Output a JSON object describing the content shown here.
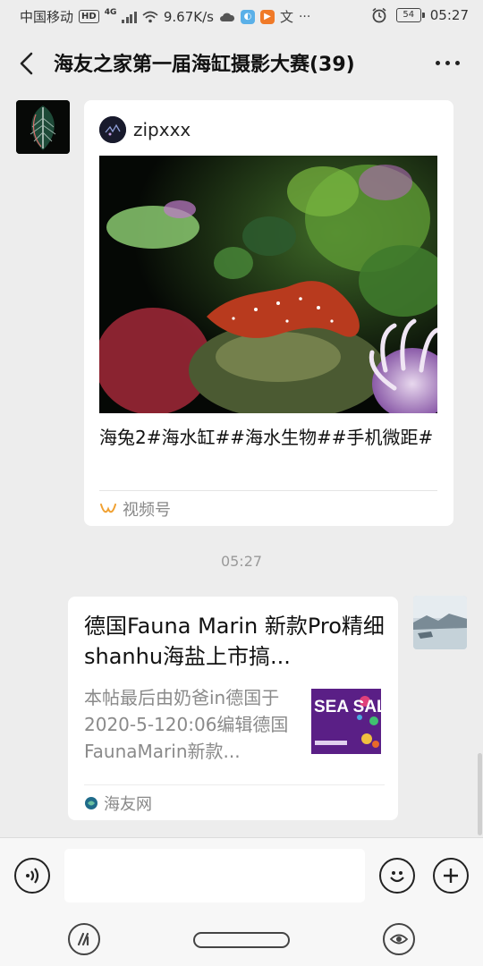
{
  "status_bar": {
    "carrier": "中国移动",
    "network_badge": "HD",
    "signal_type": "4G",
    "speed": "9.67K/s",
    "battery": "54",
    "time": "05:27",
    "icons": [
      "wifi-icon",
      "cloud-icon",
      "app-icon",
      "play-icon",
      "translate-icon",
      "more-notifications-icon",
      "alarm-icon"
    ]
  },
  "header": {
    "title": "海友之家第一届海缸摄影大赛(39)"
  },
  "messages": [
    {
      "type": "channel_video",
      "author": "zipxxx",
      "caption": "海兔2#海水缸##海水生物##手机微距#",
      "source": "视频号"
    },
    {
      "type": "timestamp",
      "time": "05:27"
    },
    {
      "type": "link_card",
      "title": "德国Fauna Marin 新款Pro精细shanhu海盐上市搞...",
      "description": "本帖最后由奶爸in德国于2020-5-120:06编辑德国FaunaMarin新款...",
      "thumbnail_text": "SEA SALT",
      "source": "海友网"
    }
  ],
  "colors": {
    "background": "#ededed",
    "bubble": "#ffffff",
    "muted_text": "#888888",
    "channel_accent": "#f0a030"
  }
}
